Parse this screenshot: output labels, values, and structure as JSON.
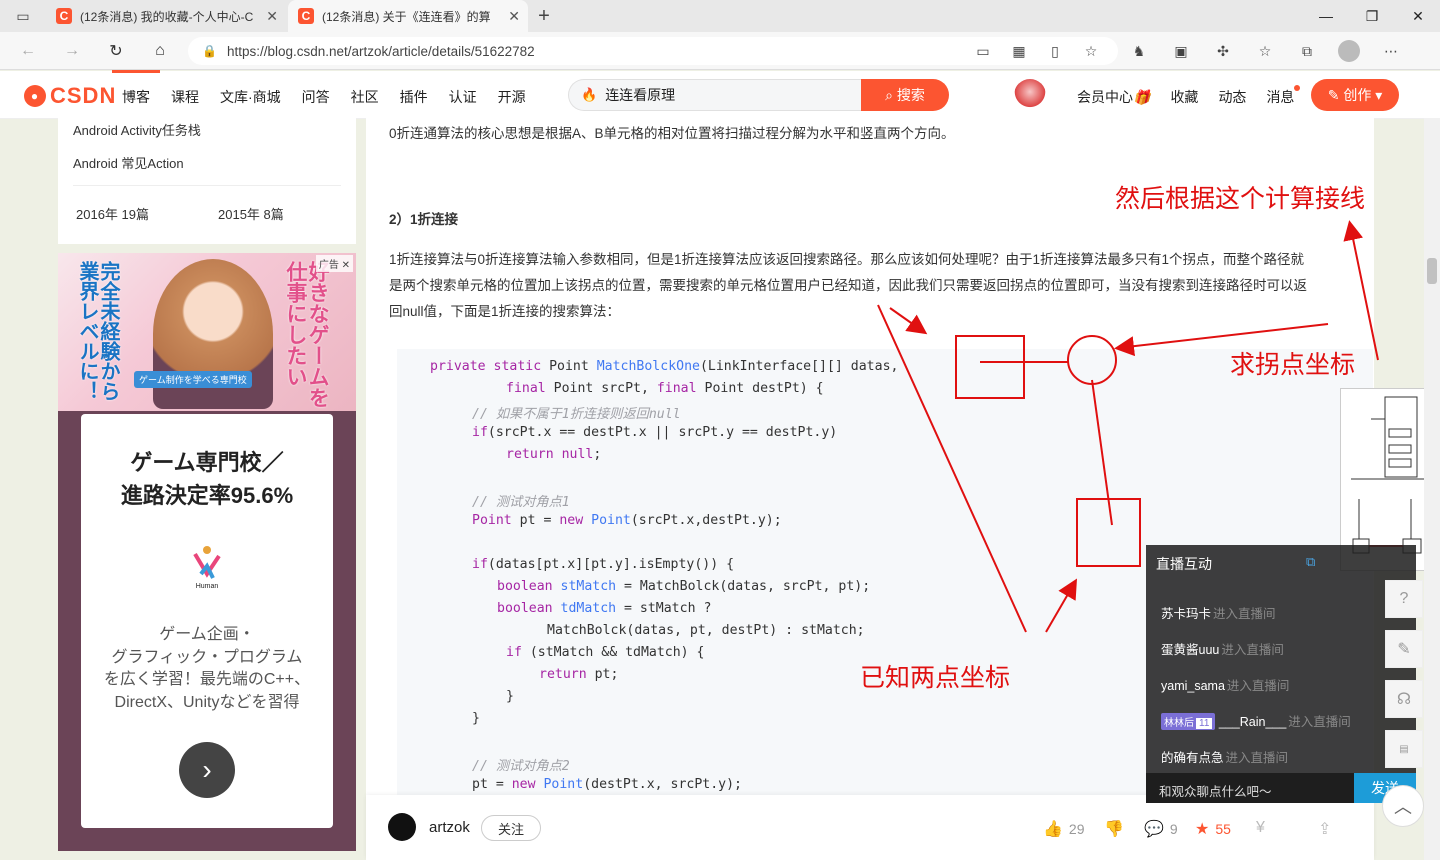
{
  "browser": {
    "tabs": [
      {
        "title": "(12条消息) 我的收藏-个人中心-C",
        "active": false
      },
      {
        "title": "(12条消息) 关于《连连看》的算",
        "active": true
      }
    ],
    "favicon_letter": "C",
    "url": "https://blog.csdn.net/artzok/article/details/51622782"
  },
  "header": {
    "logo": "CSDN",
    "nav": [
      "博客",
      "课程",
      "文库·商城",
      "问答",
      "社区",
      "插件",
      "认证",
      "开源"
    ],
    "search_value": "连连看原理",
    "search_button": "搜索",
    "right_nav": [
      "会员中心",
      "收藏",
      "动态",
      "消息"
    ],
    "create_button": "创作"
  },
  "sidebar": {
    "links": [
      "Android Activity任务栈",
      "Android 常见Action"
    ],
    "archives": [
      "2016年  19篇",
      "2015年  8篇"
    ]
  },
  "ad": {
    "tag": "广告",
    "banner_left": "完全未経験から業界レベルに！",
    "banner_right": "好きなゲームを仕事にしたい",
    "banner_badge": "ゲーム制作を学べる専門校",
    "headline_1": "ゲーム専門校／",
    "headline_2": "進路決定率95.6%",
    "logo_text": "Human",
    "body_1": "ゲーム企画・",
    "body_2": "グラフィック・プログラム",
    "body_3": "を広く学習！最先端のC++、",
    "body_4": "DirectX、Unityなどを習得"
  },
  "article": {
    "para_0": "0折连通算法的核心思想是根据A、B单元格的相对位置将扫描过程分解为水平和竖直两个方向。",
    "heading": "2）1折连接",
    "para_1a": "1折连接算法与0折连接算法输入参数相同，但是1折连接算法应该返回搜索路径。那么应该如何处理呢？由于1折连接算法最多只有1个拐点，而整个路径就",
    "para_1b": "是两个搜索单元格的位置加上该拐点的位置，需要搜索的单元格位置用户已经知道，因此我们只需要返回拐点的位置即可，当没有搜索到连接路径时可以返",
    "para_1c": "回null值，下面是1折连接的搜索算法："
  },
  "annotations": {
    "compute_line": "然后根据这个计算接线",
    "find_corner": "求拐点坐标",
    "known_points": "已知两点坐标"
  },
  "author": {
    "name": "artzok",
    "follow": "关注",
    "likes": "29",
    "comments": "9",
    "favorites": "55"
  },
  "live": {
    "title": "直播互动",
    "messages": [
      {
        "user": "苏卡玛卡",
        "action": "进入直播间"
      },
      {
        "user": "蛋黄酱uuu",
        "action": "进入直播间"
      },
      {
        "user": "yami_sama",
        "action": "进入直播间"
      },
      {
        "user": "___Rain___",
        "action": "进入直播间",
        "badge": "林林后",
        "level": "11"
      },
      {
        "user": "的确有点急",
        "action": "进入直播间"
      }
    ],
    "input_placeholder": "和观众聊点什么吧～",
    "send": "发送"
  },
  "colors": {
    "brand": "#fc5531",
    "annotation": "#e01010"
  }
}
